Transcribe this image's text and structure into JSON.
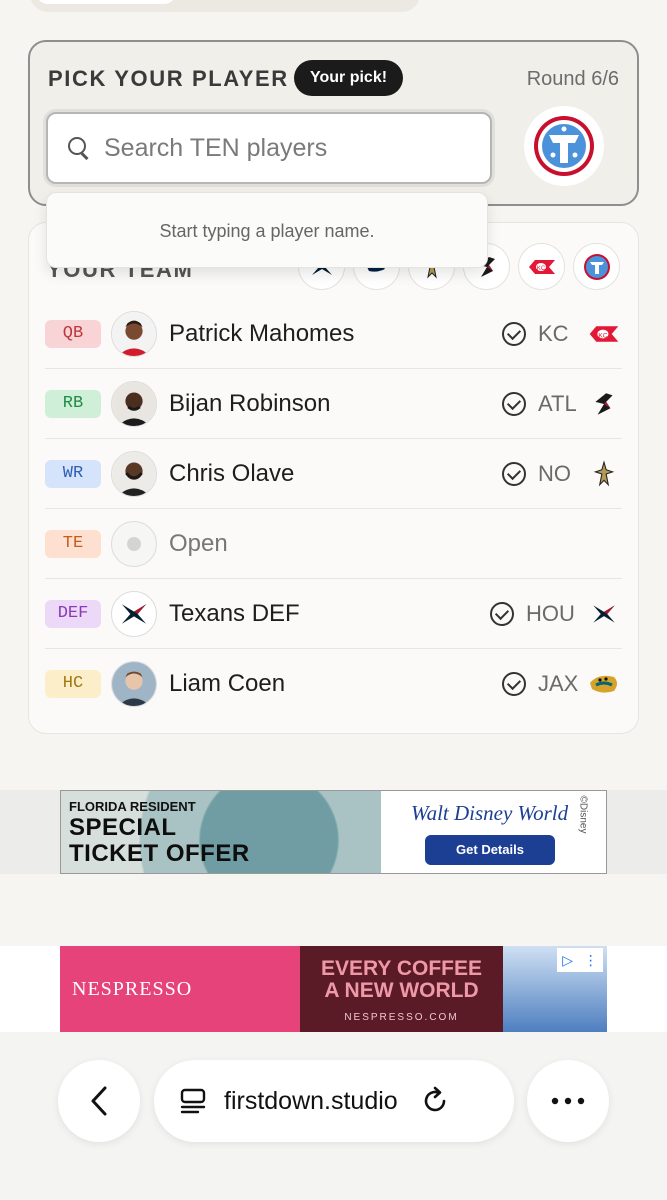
{
  "pick": {
    "title": "PICK YOUR PLAYER",
    "badge": "Your pick!",
    "round": "Round 6/6",
    "search_placeholder": "Search TEN players",
    "dropdown_hint": "Start typing a player name.",
    "team_badge_icon": "titans-logo-icon"
  },
  "team": {
    "title": "YOUR TEAM",
    "logos": [
      "texans-logo-icon",
      "seahawks-logo-icon",
      "saints-logo-icon",
      "falcons-logo-icon",
      "chiefs-logo-icon",
      "titans-logo-icon"
    ],
    "rows": [
      {
        "pos": "QB",
        "name": "Patrick Mahomes",
        "team": "KC",
        "pos_bg": "#f9d4d6",
        "pos_color": "#c0343b"
      },
      {
        "pos": "RB",
        "name": "Bijan Robinson",
        "team": "ATL",
        "pos_bg": "#cfefd8",
        "pos_color": "#218a47"
      },
      {
        "pos": "WR",
        "name": "Chris Olave",
        "team": "NO",
        "pos_bg": "#d6e4fb",
        "pos_color": "#2f5fb3"
      },
      {
        "pos": "TE",
        "name": "Open",
        "team": "",
        "pos_bg": "#fde0cf",
        "pos_color": "#c95a1d"
      },
      {
        "pos": "DEF",
        "name": "Texans DEF",
        "team": "HOU",
        "pos_bg": "#ecd8f7",
        "pos_color": "#8a3bb5"
      },
      {
        "pos": "HC",
        "name": "Liam Coen",
        "team": "JAX",
        "pos_bg": "#fbeec9",
        "pos_color": "#a07812"
      }
    ]
  },
  "ads": {
    "disney": {
      "line1": "FLORIDA RESIDENT",
      "line2a": "SPECIAL",
      "line2b": "TICKET OFFER",
      "brand": "Walt Disney World",
      "cta": "Get Details",
      "small": "©Disney"
    },
    "nespresso": {
      "logo": "NESPRESSO",
      "line1": "EVERY COFFEE",
      "line2": "A NEW WORLD",
      "url": "NESPRESSO.COM"
    }
  },
  "browser": {
    "url": "firstdown.studio",
    "back_icon": "chevron-left-icon",
    "reload_icon": "reload-icon",
    "more_icon": "more-dots-icon"
  }
}
